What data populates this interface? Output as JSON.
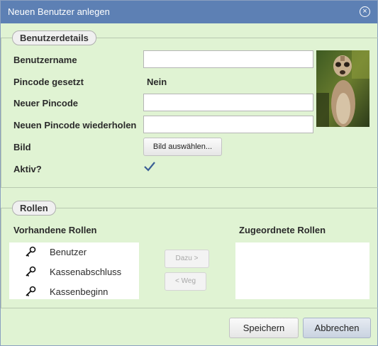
{
  "dialog": {
    "title": "Neuen Benutzer anlegen"
  },
  "details": {
    "legend": "Benutzerdetails",
    "username_label": "Benutzername",
    "username_value": "",
    "pincode_set_label": "Pincode gesetzt",
    "pincode_set_value": "Nein",
    "new_pin_label": "Neuer Pincode",
    "repeat_pin_label": "Neuen Pincode wiederholen",
    "image_label": "Bild",
    "image_button": "Bild auswählen...",
    "active_label": "Aktiv?",
    "active_checked": true
  },
  "roles": {
    "legend": "Rollen",
    "available_label": "Vorhandene Rollen",
    "assigned_label": "Zugeordnete Rollen",
    "available": [
      "Benutzer",
      "Kassenabschluss",
      "Kassenbeginn"
    ],
    "assigned": [],
    "add_button": "Dazu >",
    "remove_button": "< Weg"
  },
  "footer": {
    "save_button": "Speichern",
    "cancel_button": "Abbrechen"
  }
}
